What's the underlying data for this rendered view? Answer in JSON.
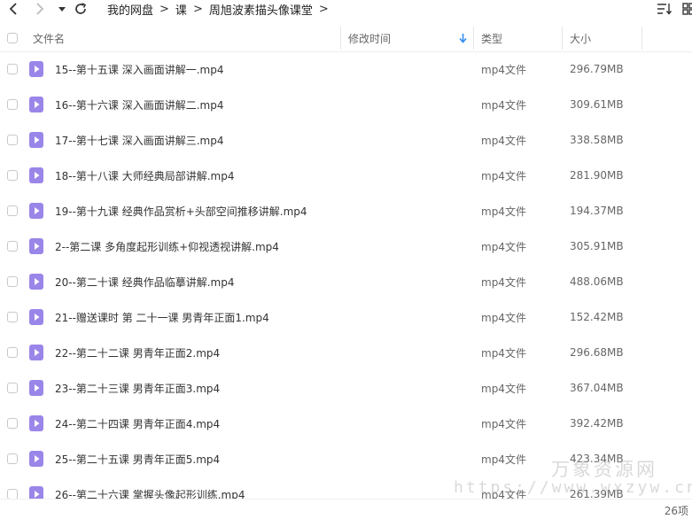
{
  "toolbar": {
    "breadcrumb": [
      "我的网盘",
      "课",
      "周旭波素描头像课堂"
    ]
  },
  "header": {
    "name": "文件名",
    "modified": "修改时间",
    "type": "类型",
    "size": "大小"
  },
  "files": [
    {
      "name": "15--第十五课 深入画面讲解一.mp4",
      "type": "mp4文件",
      "size": "296.79MB"
    },
    {
      "name": "16--第十六课 深入画面讲解二.mp4",
      "type": "mp4文件",
      "size": "309.61MB"
    },
    {
      "name": "17--第十七课 深入画面讲解三.mp4",
      "type": "mp4文件",
      "size": "338.58MB"
    },
    {
      "name": "18--第十八课 大师经典局部讲解.mp4",
      "type": "mp4文件",
      "size": "281.90MB"
    },
    {
      "name": "19--第十九课 经典作品赏析+头部空间推移讲解.mp4",
      "type": "mp4文件",
      "size": "194.37MB"
    },
    {
      "name": "2--第二课 多角度起形训练+仰视透视讲解.mp4",
      "type": "mp4文件",
      "size": "305.91MB"
    },
    {
      "name": "20--第二十课 经典作品临摹讲解.mp4",
      "type": "mp4文件",
      "size": "488.06MB"
    },
    {
      "name": "21--赠送课时 第 二十一课 男青年正面1.mp4",
      "type": "mp4文件",
      "size": "152.42MB"
    },
    {
      "name": "22--第二十二课 男青年正面2.mp4",
      "type": "mp4文件",
      "size": "296.68MB"
    },
    {
      "name": "23--第二十三课 男青年正面3.mp4",
      "type": "mp4文件",
      "size": "367.04MB"
    },
    {
      "name": "24--第二十四课 男青年正面4.mp4",
      "type": "mp4文件",
      "size": "392.42MB"
    },
    {
      "name": "25--第二十五课 男青年正面5.mp4",
      "type": "mp4文件",
      "size": "423.34MB"
    },
    {
      "name": "26--第二十六课 掌握头像起形训练.mp4",
      "type": "mp4文件",
      "size": "261.39MB"
    }
  ],
  "watermark": {
    "title": "万象资源网",
    "url": "https://www.wxzyw.cn"
  },
  "footer": {
    "count": "26项"
  },
  "colors": {
    "file_icon": "#9a86e8",
    "sort_arrow": "#2f8cf0"
  }
}
